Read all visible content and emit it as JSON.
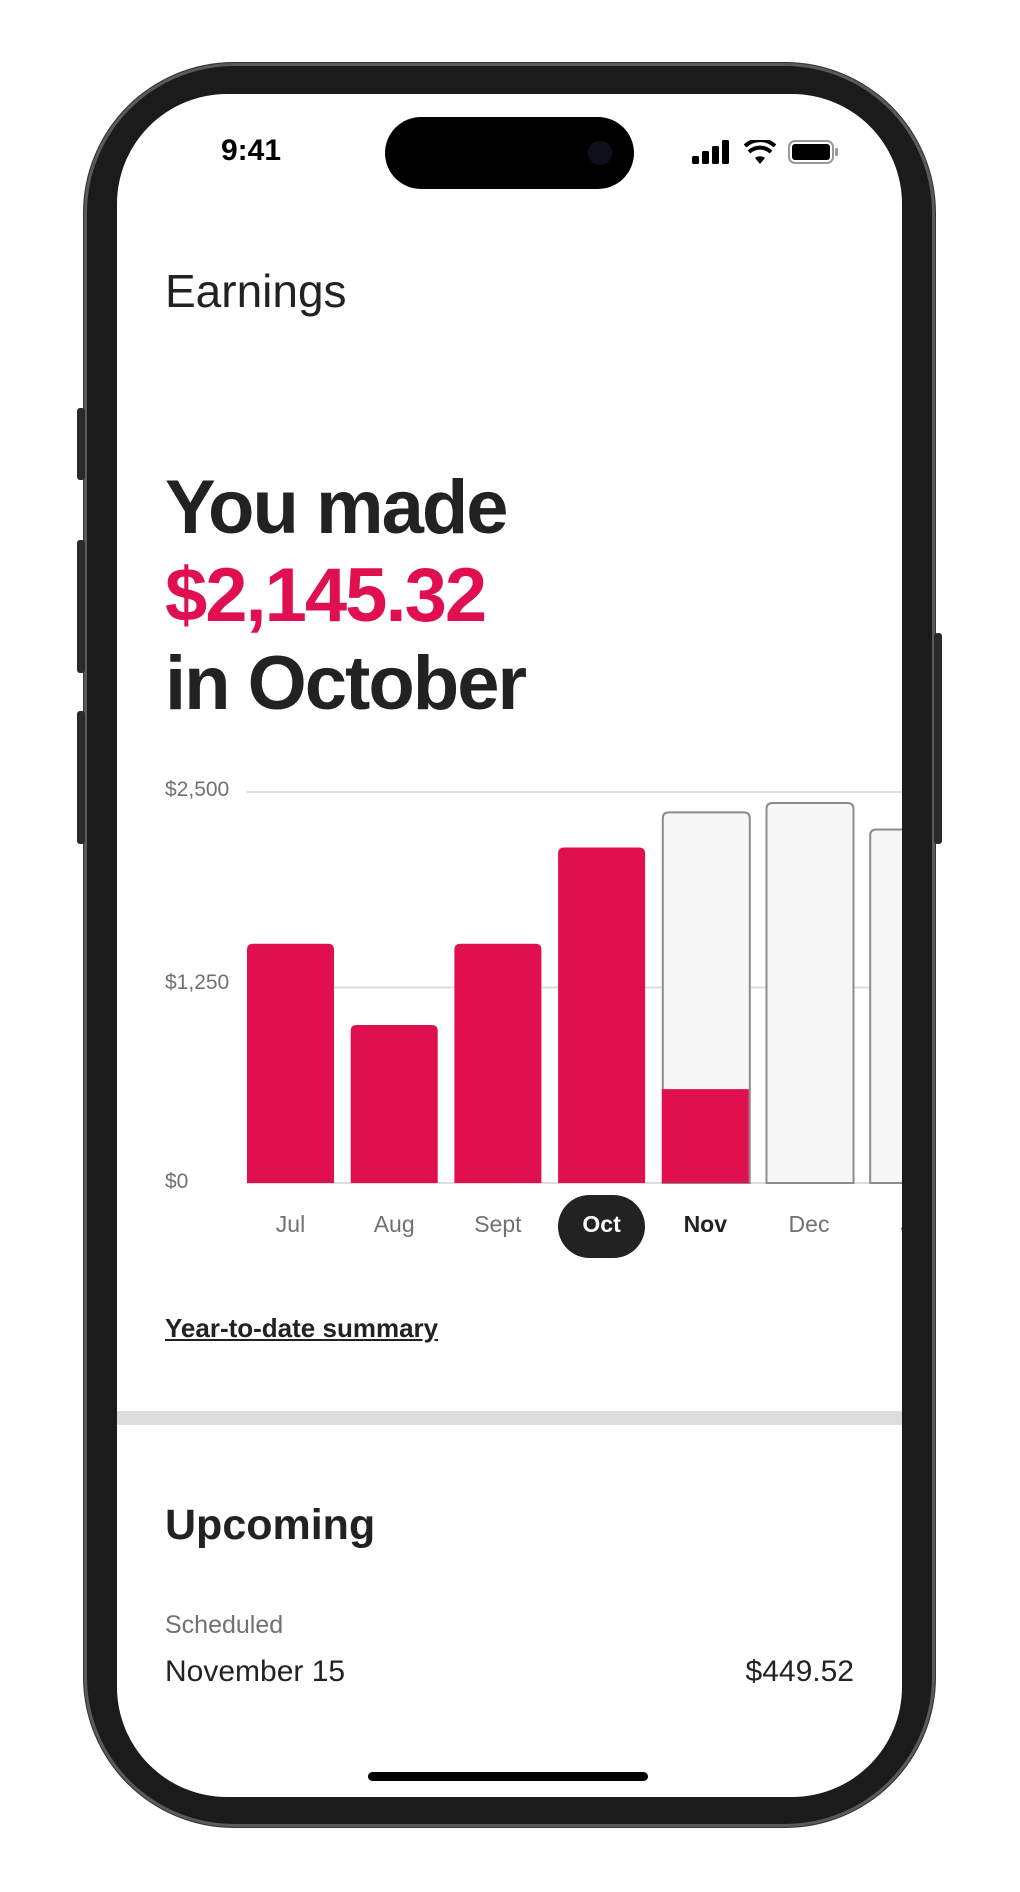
{
  "status_bar": {
    "time": "9:41"
  },
  "header": {
    "title": "Earnings"
  },
  "hero": {
    "line1": "You made",
    "amount": "$2,145.32",
    "line3": "in October"
  },
  "colors": {
    "accent": "#E00F50",
    "dark": "#222222",
    "projected_fill": "#F7F7F7",
    "projected_stroke": "#8C8C8C"
  },
  "chart_data": {
    "type": "bar",
    "categories": [
      "Jul",
      "Aug",
      "Sept",
      "Oct",
      "Nov",
      "Dec",
      "Jan"
    ],
    "category_labels_visible": [
      "Jul",
      "Aug",
      "Sept",
      "Oct",
      "Nov",
      "Dec",
      "Ja"
    ],
    "series": [
      {
        "values": [
          1530,
          1010,
          1530,
          2145.32,
          600,
          null,
          null
        ]
      },
      {
        "values": [
          null,
          null,
          null,
          null,
          2370,
          2430,
          2260
        ],
        "style": "projected"
      }
    ],
    "yticks": [
      {
        "value": 0,
        "label": "$0"
      },
      {
        "value": 1250,
        "label": "$1,250"
      },
      {
        "value": 2500,
        "label": "$2,500"
      }
    ],
    "ylim": [
      0,
      2500
    ],
    "grid": true,
    "selected": "Oct",
    "current": "Nov"
  },
  "links": {
    "ytd": "Year-to-date summary"
  },
  "upcoming": {
    "title": "Upcoming",
    "label": "Scheduled",
    "date": "November 15",
    "amount": "$449.52"
  }
}
